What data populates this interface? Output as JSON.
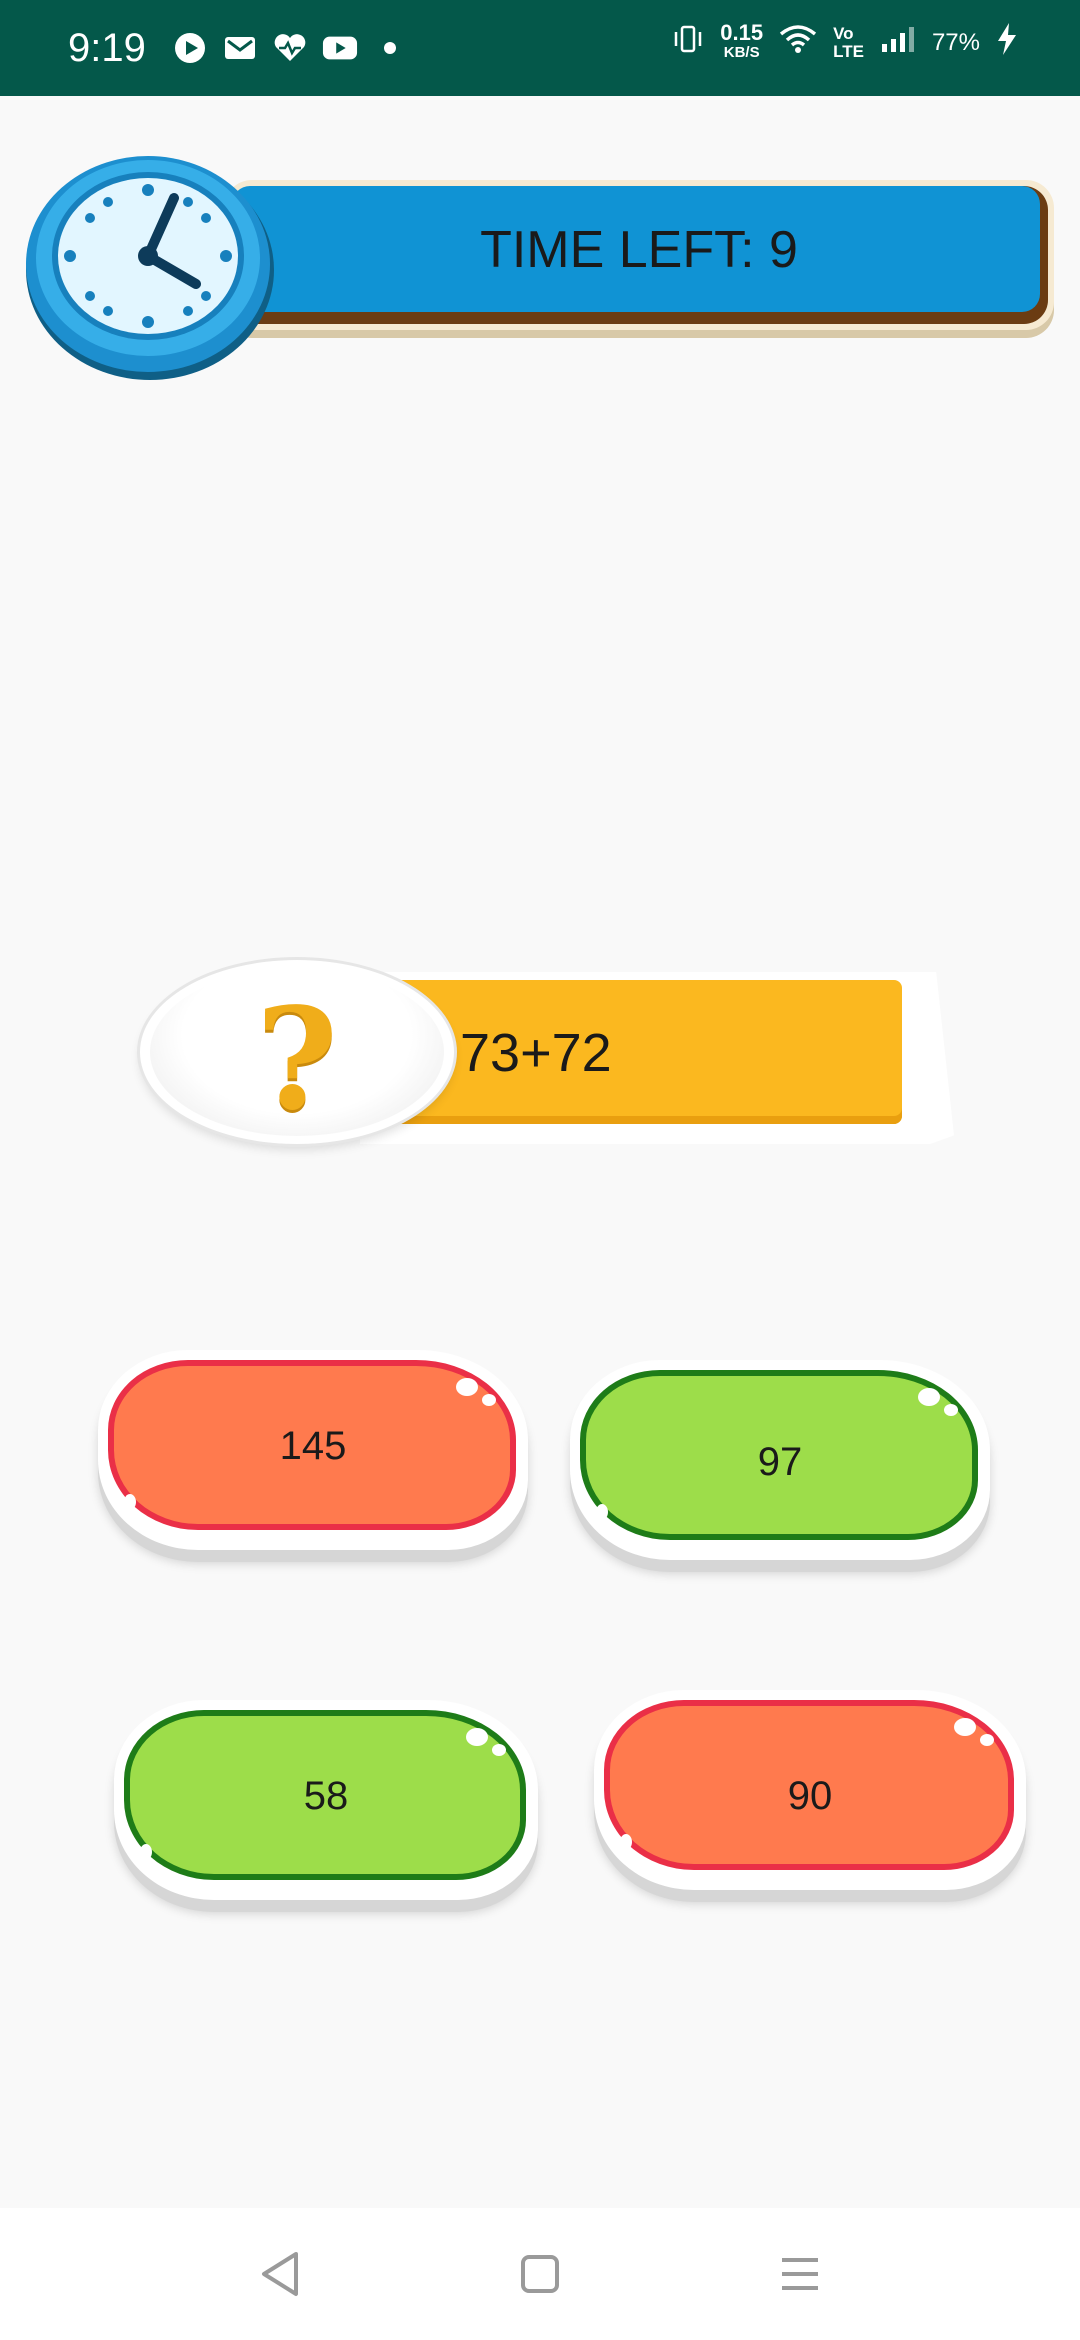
{
  "status_bar": {
    "time": "9:19",
    "left_icons": [
      "play-icon",
      "gmail-icon",
      "health-icon",
      "youtube-icon",
      "dot-icon"
    ],
    "net_speed_value": "0.15",
    "net_speed_unit": "KB/S",
    "volte_top": "Vo",
    "volte_bottom": "LTE",
    "battery": "77%"
  },
  "timer": {
    "label": "TIME LEFT: 9"
  },
  "question": {
    "mark": "?",
    "expression": "73+72"
  },
  "answers": [
    {
      "label": "145",
      "color": "red"
    },
    {
      "label": "97",
      "color": "green"
    },
    {
      "label": "58",
      "color": "green"
    },
    {
      "label": "90",
      "color": "red"
    }
  ],
  "colors": {
    "status_bar": "#04584a",
    "timer_blue": "#1093d4",
    "question_yellow": "#fbb81f",
    "answer_red": "#ff7a4e",
    "answer_green": "#9ddd4a"
  }
}
